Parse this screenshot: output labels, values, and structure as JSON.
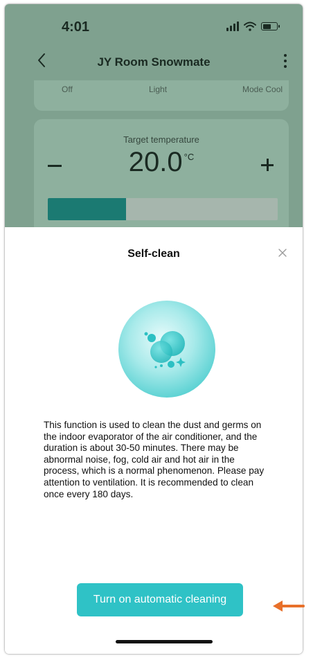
{
  "status_bar": {
    "time": "4:01",
    "icons": [
      "signal-icon",
      "wifi-icon",
      "battery-icon"
    ]
  },
  "nav": {
    "title": "JY Room Snowmate",
    "back_icon": "chevron-left-icon",
    "more_icon": "more-vertical-icon"
  },
  "mode_row": {
    "items": [
      "Off",
      "Light",
      "Mode Cool"
    ]
  },
  "temperature": {
    "label": "Target temperature",
    "value": "20.0",
    "unit": "°C",
    "slider_fraction": 0.34
  },
  "dialog": {
    "title": "Self-clean",
    "close_icon": "close-icon",
    "hero_icon": "self-clean-bubbles-icon",
    "description": "This function is used to clean the dust and germs on the indoor evaporator of the air conditioner, and the duration is about 30-50 minutes. There may be abnormal noise, fog, cold air and hot air in the process, which is a normal phenomenon. Please pay attention to ventilation. It is recommended to clean once every 180 days.",
    "button_label": "Turn on automatic cleaning"
  },
  "colors": {
    "accent": "#2fc2c6",
    "overlay_bg": "#7fa18f",
    "slider_fill": "#1b7a72",
    "annotation": "#e8702a"
  }
}
